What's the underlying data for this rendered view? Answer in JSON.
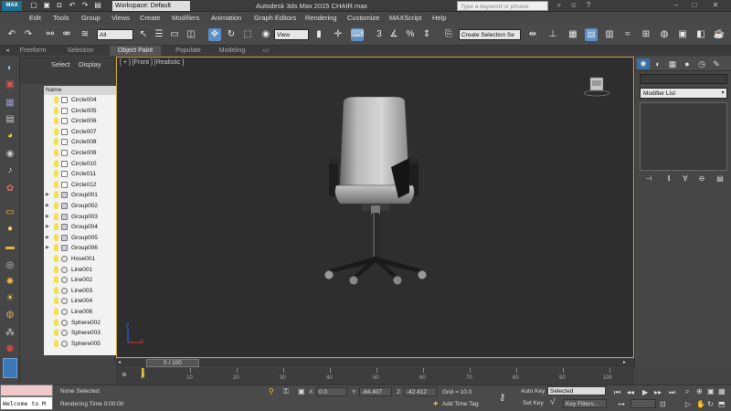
{
  "titlebar": {
    "app_icon": "MAX",
    "workspace": "Workspace: Default",
    "title": "Autodesk 3ds Max  2015    CHAIR.max",
    "search_placeholder": "Type a keyword or phrase",
    "window_buttons": [
      "–",
      "□",
      "✕"
    ]
  },
  "menubar": {
    "items": [
      "Edit",
      "Tools",
      "Group",
      "Views",
      "Create",
      "Modifiers",
      "Animation",
      "Graph Editors",
      "Rendering",
      "Customize",
      "MAXScript",
      "Help"
    ]
  },
  "toolbar": {
    "selection_filter": "All",
    "reference_coord": "View",
    "named_selection": "Create Selection Se"
  },
  "ribbon": {
    "tabs": [
      "Freeform",
      "Selection",
      "Object Paint",
      "Populate",
      "Modeling"
    ],
    "active": "Object Paint"
  },
  "explorer": {
    "tab_select": "Select",
    "tab_display": "Display",
    "column_name": "Name",
    "rows": [
      {
        "label": "Circle004",
        "type": "shape",
        "group": false
      },
      {
        "label": "Circle005",
        "type": "shape",
        "group": false
      },
      {
        "label": "Circle006",
        "type": "shape",
        "group": false
      },
      {
        "label": "Circle007",
        "type": "shape",
        "group": false
      },
      {
        "label": "Circle008",
        "type": "shape",
        "group": false
      },
      {
        "label": "Circle009",
        "type": "shape",
        "group": false
      },
      {
        "label": "Circle010",
        "type": "shape",
        "group": false
      },
      {
        "label": "Circle011",
        "type": "shape",
        "group": false
      },
      {
        "label": "Circle012",
        "type": "shape",
        "group": false
      },
      {
        "label": "Group001",
        "type": "group",
        "group": true
      },
      {
        "label": "Group002",
        "type": "group",
        "group": true
      },
      {
        "label": "Group003",
        "type": "group",
        "group": true
      },
      {
        "label": "Group004",
        "type": "group",
        "group": true
      },
      {
        "label": "Group005",
        "type": "group",
        "group": true
      },
      {
        "label": "Group006",
        "type": "group",
        "group": true
      },
      {
        "label": "Hose001",
        "type": "mesh",
        "group": false
      },
      {
        "label": "Line001",
        "type": "mesh",
        "group": false
      },
      {
        "label": "Line002",
        "type": "mesh",
        "group": false
      },
      {
        "label": "Line003",
        "type": "mesh",
        "group": false
      },
      {
        "label": "Line004",
        "type": "mesh",
        "group": false
      },
      {
        "label": "Line006",
        "type": "mesh",
        "group": false
      },
      {
        "label": "Sphere002",
        "type": "mesh",
        "group": false
      },
      {
        "label": "Sphere003",
        "type": "mesh",
        "group": false
      },
      {
        "label": "Sphere005",
        "type": "mesh",
        "group": false
      }
    ]
  },
  "viewport": {
    "label": "[ + ] [Front ] [Realistic ]",
    "axis_x": "x",
    "axis_y": "y"
  },
  "command_panel": {
    "modifier_list": "Modifier List"
  },
  "timeline": {
    "slider_text": "0 / 100",
    "ticks": [
      "0",
      "10",
      "20",
      "30",
      "40",
      "50",
      "60",
      "70",
      "80",
      "90",
      "100"
    ]
  },
  "status": {
    "maxscript_text": "Welcome to M",
    "selection": "None Selected",
    "rendering_time": "Rendering Time  0:00:00",
    "x_label": "X:",
    "x_value": "0.0",
    "y_label": "Y:",
    "y_value": "-84.407",
    "z_label": "Z:",
    "z_value": "-42.412",
    "grid": "Grid = 10.0",
    "add_time_tag": "Add Time Tag",
    "auto_key": "Auto Key",
    "auto_key_value": "Selected",
    "set_key": "Set Key",
    "key_filters": "Key Filters..."
  },
  "colors": {
    "viewport_border": "#c9a43a",
    "accent": "#5a8fc8"
  }
}
